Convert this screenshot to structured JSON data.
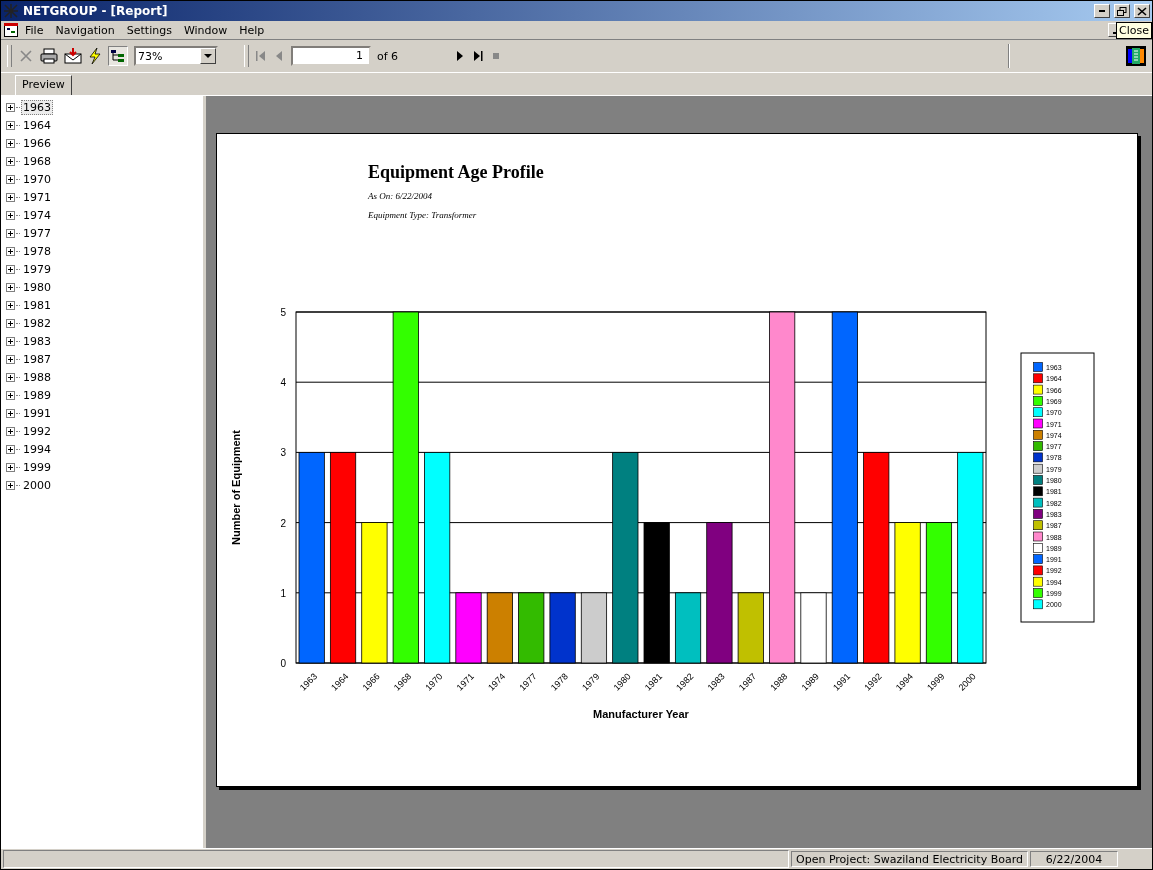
{
  "window": {
    "title": "NETGROUP - [Report]"
  },
  "menu": [
    "File",
    "Navigation",
    "Settings",
    "Window",
    "Help"
  ],
  "tooltip": {
    "text": "Close"
  },
  "toolbar": {
    "zoom": "73%",
    "page": "1",
    "page_count": "of 6",
    "tree_toggle_on": true
  },
  "tabs": [
    {
      "label": "Preview",
      "selected": true
    }
  ],
  "tree": {
    "items": [
      {
        "label": "1963",
        "selected": true,
        "expanded": false
      },
      {
        "label": "1964",
        "selected": false,
        "expanded": false
      },
      {
        "label": "1966",
        "selected": false,
        "expanded": false
      },
      {
        "label": "1968",
        "selected": false,
        "expanded": false
      },
      {
        "label": "1970",
        "selected": false,
        "expanded": false
      },
      {
        "label": "1971",
        "selected": false,
        "expanded": false
      },
      {
        "label": "1974",
        "selected": false,
        "expanded": false
      },
      {
        "label": "1977",
        "selected": false,
        "expanded": false
      },
      {
        "label": "1978",
        "selected": false,
        "expanded": false
      },
      {
        "label": "1979",
        "selected": false,
        "expanded": false
      },
      {
        "label": "1980",
        "selected": false,
        "expanded": false
      },
      {
        "label": "1981",
        "selected": false,
        "expanded": false
      },
      {
        "label": "1982",
        "selected": false,
        "expanded": false
      },
      {
        "label": "1983",
        "selected": false,
        "expanded": false
      },
      {
        "label": "1987",
        "selected": false,
        "expanded": false
      },
      {
        "label": "1988",
        "selected": false,
        "expanded": false
      },
      {
        "label": "1989",
        "selected": false,
        "expanded": false
      },
      {
        "label": "1991",
        "selected": false,
        "expanded": false
      },
      {
        "label": "1992",
        "selected": false,
        "expanded": false
      },
      {
        "label": "1994",
        "selected": false,
        "expanded": false
      },
      {
        "label": "1999",
        "selected": false,
        "expanded": false
      },
      {
        "label": "2000",
        "selected": false,
        "expanded": false
      }
    ]
  },
  "report": {
    "title": "Equipment Age Profile",
    "as_on": "As On: 6/22/2004",
    "equipment_type": "Equipment Type: Transformer",
    "chart_data": {
      "type": "bar",
      "xlabel": "Manufacturer Year",
      "ylabel": "Number of Equipment",
      "ylim": [
        0,
        5
      ],
      "yticks": [
        0,
        1,
        2,
        3,
        4,
        5
      ],
      "categories": [
        "1963",
        "1964",
        "1966",
        "1968",
        "1970",
        "1971",
        "1974",
        "1977",
        "1978",
        "1979",
        "1980",
        "1981",
        "1982",
        "1983",
        "1987",
        "1988",
        "1989",
        "1991",
        "1992",
        "1994",
        "1999",
        "2000"
      ],
      "grid": true,
      "series": [
        {
          "values": [
            3,
            3,
            2,
            5,
            3,
            1,
            1,
            1,
            1,
            1,
            3,
            2,
            1,
            2,
            1,
            5,
            1,
            5,
            3,
            2,
            2,
            3
          ]
        }
      ]
    },
    "legend": [
      {
        "label": "1963",
        "color": "#0066ff"
      },
      {
        "label": "1964",
        "color": "#ff0000"
      },
      {
        "label": "1966",
        "color": "#ffff00"
      },
      {
        "label": "1969",
        "color": "#33ff00"
      },
      {
        "label": "1970",
        "color": "#00ffff"
      },
      {
        "label": "1971",
        "color": "#ff00ff"
      },
      {
        "label": "1974",
        "color": "#cc8000"
      },
      {
        "label": "1977",
        "color": "#33bb00"
      },
      {
        "label": "1978",
        "color": "#0033cc"
      },
      {
        "label": "1979",
        "color": "#cccccc"
      },
      {
        "label": "1980",
        "color": "#008080"
      },
      {
        "label": "1981",
        "color": "#000000"
      },
      {
        "label": "1982",
        "color": "#00bfbf"
      },
      {
        "label": "1983",
        "color": "#800080"
      },
      {
        "label": "1987",
        "color": "#c0c000"
      },
      {
        "label": "1988",
        "color": "#ff88cc"
      },
      {
        "label": "1989",
        "color": "#ffffff"
      },
      {
        "label": "1991",
        "color": "#0066ff"
      },
      {
        "label": "1992",
        "color": "#ff0000"
      },
      {
        "label": "1994",
        "color": "#ffff00"
      },
      {
        "label": "1999",
        "color": "#33ff00"
      },
      {
        "label": "2000",
        "color": "#00ffff"
      }
    ]
  },
  "status_bar": [
    "Open Project: Swaziland Electricity Board",
    "6/22/2004"
  ]
}
